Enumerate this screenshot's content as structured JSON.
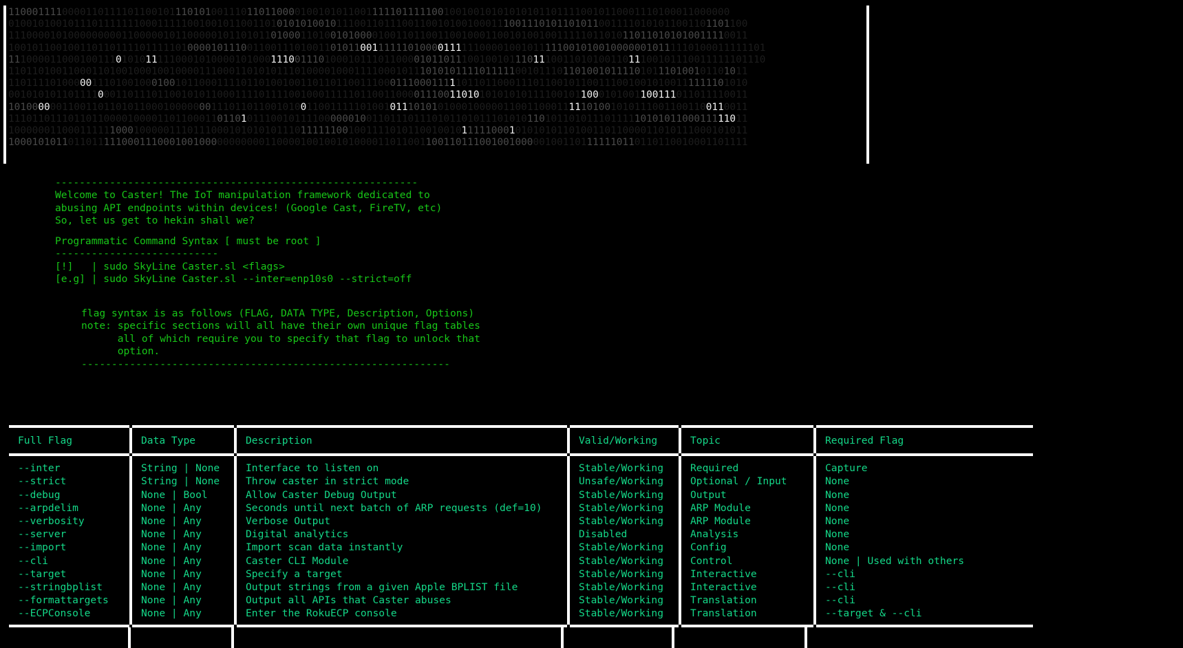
{
  "banner": {
    "name": "binary-matrix-banner",
    "rows": [
      "1100011110000110111101100101110101001110110110000100101011001111101111100100100101010101011011110010110001110100011000000",
      "0100101001011101111111000111110010010110011010101010010111001101110011001010010001110011101011010110011110101011001101101100",
      "1110000101000000000110000010110000010110101101000110100101000010011011001100100011001010010011111011010110110101010011110011",
      "1001011001001101101111011111010000101110011001110100110101100111111010000111111000010010111110010100100000010111110100011111101",
      "1110000110001001110101011111000101000010100011100111010001011101100001011011100100101110111001101010011011100101110011111101110",
      "1101101001100011010010001001000011100011010101110100001000111100010111010101111011111001011101101001011110101110100101101011",
      "1101111010000011101001000100101100011110110100100110110110011100011100011111011011000111011001011001110010010100111111101010",
      "0010101011011110001101110110010101100011110111100100011111011001100001110011010101010101111001011000101001100111011011110011",
      "1010000001100110110101100010000000111011011001010011001111101001011101010100010000011001100011111010010101110011001100110011",
      "1110110111011011000010000110110001101101011100101111000000100110111011101011010111010101101011010111011111010101100011111011",
      "1000000110001111110001000001110111000101010101110111111001001111010110010010111110001010101011010011011000011010111000101011",
      "1000101011011011111000111000100100000000000110000100100101000011011001100110111001001000001001101111110110110110010001101111"
    ],
    "highlight_style": "random-bit-highlight"
  },
  "intro": {
    "divider": "------------------------------------------------------------",
    "lines": [
      "Welcome to Caster! The IoT manipulation framework dedicated to",
      "abusing API endpoints within devices! (Google Cast, FireTV, etc)",
      "So, let us get to hekin shall we?"
    ]
  },
  "syntax": {
    "title": "Programmatic Command Syntax [ must be root ]",
    "divider": "---------------------------",
    "lines": [
      "[!]   | sudo SkyLine Caster.sl <flags>",
      "[e.g] | sudo SkyLine Caster.sl --inter=enp10s0 --strict=off"
    ]
  },
  "note": {
    "lines": [
      "flag syntax is as follows (FLAG, DATA TYPE, Description, Options)",
      "note: specific sections will all have their own unique flag tables",
      "      all of which require you to specify that flag to unlock that",
      "      option.",
      "-------------------------------------------------------------"
    ]
  },
  "table": {
    "headers": [
      "Full Flag",
      "Data Type",
      "Description",
      "Valid/Working",
      "Topic",
      "Required Flag"
    ],
    "rows": [
      {
        "flag": "--inter",
        "data_type": "String | None",
        "description": "Interface to listen on",
        "valid": "Stable/Working",
        "topic": "Required",
        "required_flag": "Capture"
      },
      {
        "flag": "--strict",
        "data_type": "String | None",
        "description": "Throw caster in strict mode",
        "valid": "Unsafe/Working",
        "topic": "Optional / Input",
        "required_flag": "None"
      },
      {
        "flag": "--debug",
        "data_type": "None | Bool",
        "description": "Allow Caster Debug Output",
        "valid": "Stable/Working",
        "topic": "Output",
        "required_flag": "None"
      },
      {
        "flag": "--arpdelim",
        "data_type": "None | Any",
        "description": "Seconds until next batch of ARP requests (def=10)",
        "valid": "Stable/Working",
        "topic": "ARP Module",
        "required_flag": "None"
      },
      {
        "flag": "--verbosity",
        "data_type": "None | Any",
        "description": "Verbose Output",
        "valid": "Stable/Working",
        "topic": "ARP Module",
        "required_flag": "None"
      },
      {
        "flag": "--server",
        "data_type": "None | Any",
        "description": "Digital analytics",
        "valid": "Disabled",
        "topic": "Analysis",
        "required_flag": "None"
      },
      {
        "flag": "--import",
        "data_type": "None | Any",
        "description": "Import scan data instantly",
        "valid": "Stable/Working",
        "topic": "Config",
        "required_flag": "None"
      },
      {
        "flag": "--cli",
        "data_type": "None | Any",
        "description": "Caster CLI Module",
        "valid": "Stable/Working",
        "topic": "Control",
        "required_flag": "None | Used with others"
      },
      {
        "flag": "--target",
        "data_type": "None | Any",
        "description": "Specify a target",
        "valid": "Stable/Working",
        "topic": "Interactive",
        "required_flag": "--cli"
      },
      {
        "flag": "--stringbplist",
        "data_type": "None | Any",
        "description": "Output strings from a given Apple BPLIST file",
        "valid": "Stable/Working",
        "topic": "Interactive",
        "required_flag": "--cli"
      },
      {
        "flag": "--formattargets",
        "data_type": "None | Any",
        "description": "Output all APIs that Caster abuses",
        "valid": "Stable/Working",
        "topic": "Translation",
        "required_flag": "--cli"
      },
      {
        "flag": "--ECPConsole",
        "data_type": "None | Any",
        "description": "Enter the RokuECP console",
        "valid": "Stable/Working",
        "topic": "Translation",
        "required_flag": "--target & --cli"
      }
    ]
  },
  "colors": {
    "terminal_green": "#18c718",
    "table_green": "#14d888",
    "rule_white": "#ffffff",
    "background": "#000000",
    "binary_dim": "#1d1d1d",
    "binary_bright": "#f2f2f2"
  }
}
